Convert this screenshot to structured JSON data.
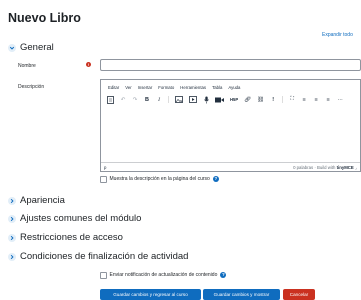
{
  "page": {
    "title": "Nuevo Libro",
    "expand_all": "Expandir todo"
  },
  "sections": {
    "general": "General",
    "appearance": "Apariencia",
    "module_settings": "Ajustes comunes del módulo",
    "restrictions": "Restricciones de acceso",
    "completion": "Condiciones de finalización de actividad"
  },
  "fields": {
    "name_label": "Nombre",
    "name_value": "",
    "description_label": "Descripción"
  },
  "editor": {
    "menu": [
      "Editar",
      "Ver",
      "Insertar",
      "Formato",
      "Herramientas",
      "Tabla",
      "Ayuda"
    ],
    "status_path": "p",
    "word_count": "0 palabras",
    "built_with": "Build with",
    "brand": "tinyMCE"
  },
  "checkboxes": {
    "show_description": "Muestra la descripción en la página del curso",
    "notify_update": "Enviar notificación de actualización de contenido"
  },
  "buttons": {
    "save_return": "Guardar cambios y regresar al curso",
    "save_display": "Guardar cambios y mostrar",
    "cancel": "Cancelar"
  },
  "colors": {
    "primary": "#0f6cbf",
    "danger": "#ca3120",
    "required": "#ca3120"
  }
}
